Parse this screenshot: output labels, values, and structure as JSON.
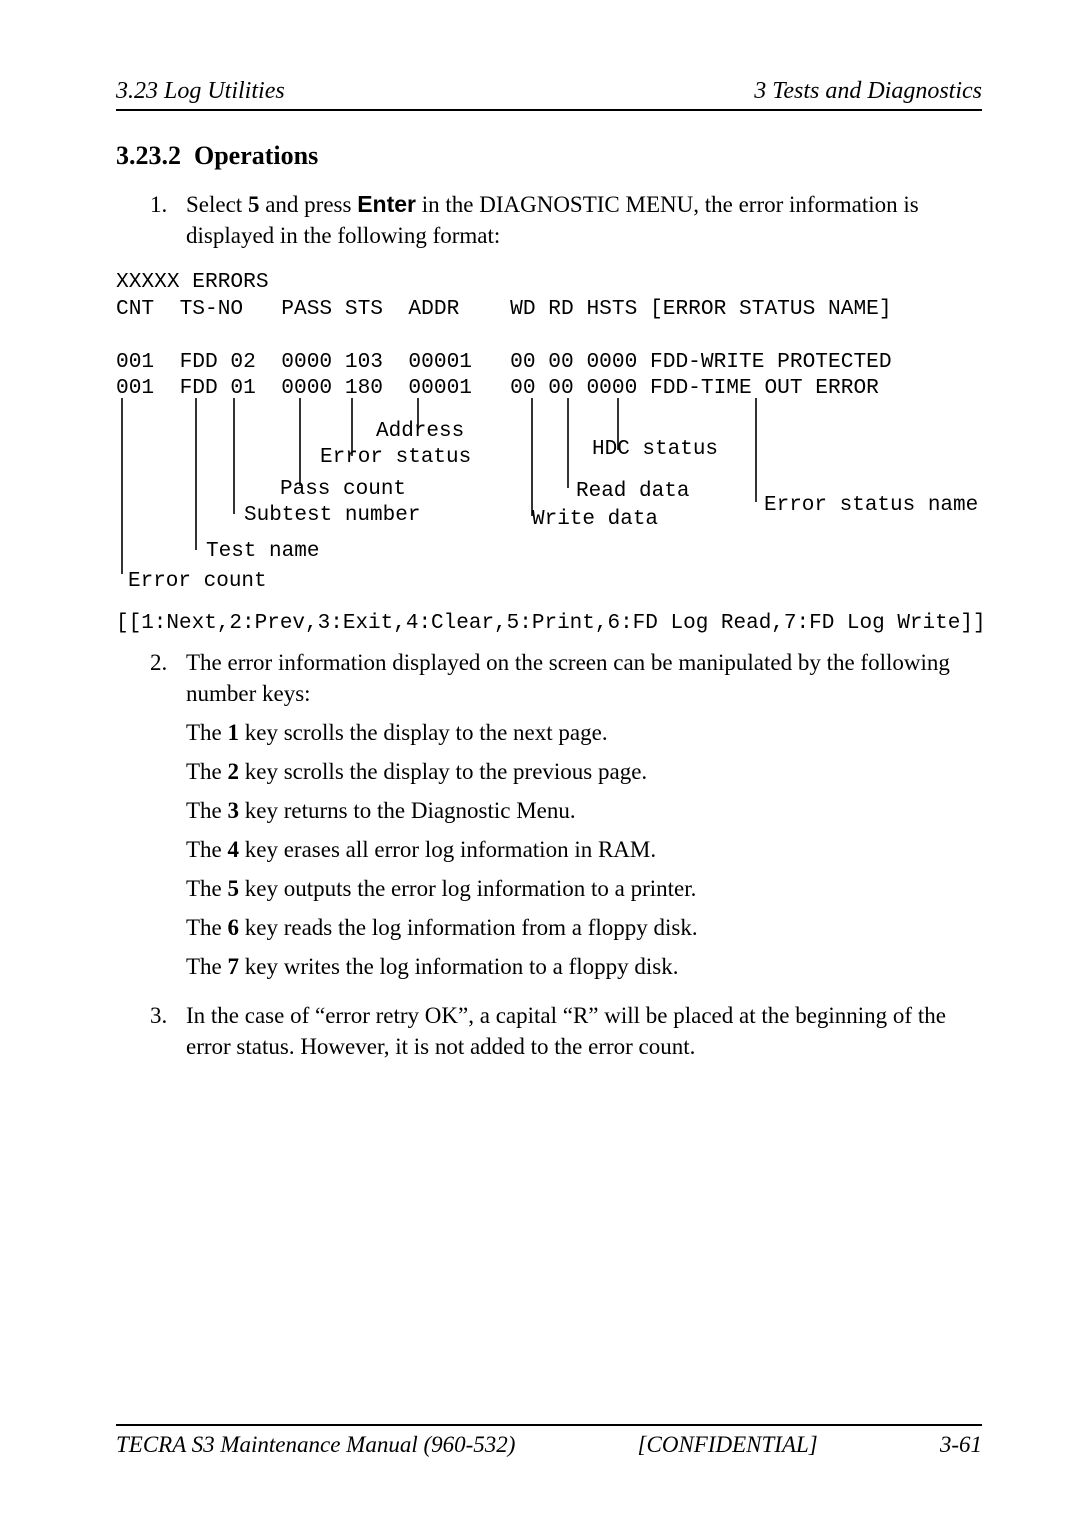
{
  "header": {
    "left": "3.23  Log Utilities",
    "right": "3  Tests and Diagnostics"
  },
  "section": {
    "number": "3.23.2",
    "title": "Operations"
  },
  "step1": {
    "num": "1.",
    "text_a": "Select ",
    "key1": "5",
    "text_b": " and press ",
    "key2": "Enter",
    "text_c": " in the DIAGNOSTIC MENU, the error information is displayed in the following format:"
  },
  "errlog": {
    "l1": "XXXXX ERRORS",
    "l2": "CNT  TS-NO   PASS STS  ADDR    WD RD HSTS [ERROR STATUS NAME]",
    "l3": "001  FDD 02  0000 103  00001   00 00 0000 FDD-WRITE PROTECTED",
    "l4": "001  FDD 01  0000 180  00001   00 00 0000 FDD-TIME OUT ERROR"
  },
  "labels": {
    "address": "Address",
    "error_status": "Error status",
    "pass_count": "Pass count",
    "subtest_number": "Subtest number",
    "test_name": "Test name",
    "error_count": "Error count",
    "hdc_status": "HDC status",
    "read_data": "Read data",
    "write_data": "Write data",
    "error_status_name": "Error status name"
  },
  "menu_footer": "[[1:Next,2:Prev,3:Exit,4:Clear,5:Print,6:FD Log Read,7:FD Log Write]]",
  "step2": {
    "num": "2.",
    "text": "The error information displayed on the screen can be manipulated by the following number keys:"
  },
  "keys": {
    "k1a": "The ",
    "k1b": "1",
    "k1c": " key scrolls the display to the next page.",
    "k2a": "The ",
    "k2b": "2",
    "k2c": " key scrolls the display to the previous page.",
    "k3a": "The ",
    "k3b": "3",
    "k3c": " key returns to the Diagnostic Menu.",
    "k4a": "The ",
    "k4b": "4",
    "k4c": " key erases all error log information in RAM.",
    "k5a": "The ",
    "k5b": "5",
    "k5c": " key outputs the error log information to a printer.",
    "k6a": "The ",
    "k6b": "6",
    "k6c": " key reads the log information from a floppy disk.",
    "k7a": "The ",
    "k7b": "7",
    "k7c": " key writes the log information to a floppy disk."
  },
  "step3": {
    "num": "3.",
    "text": "In the case of “error retry OK”, a capital “R” will be placed at the beginning of the error status. However, it is not added to the error count."
  },
  "footer": {
    "left": "TECRA S3 Maintenance Manual (960-532)",
    "center": "[CONFIDENTIAL]",
    "right": "3-61"
  }
}
